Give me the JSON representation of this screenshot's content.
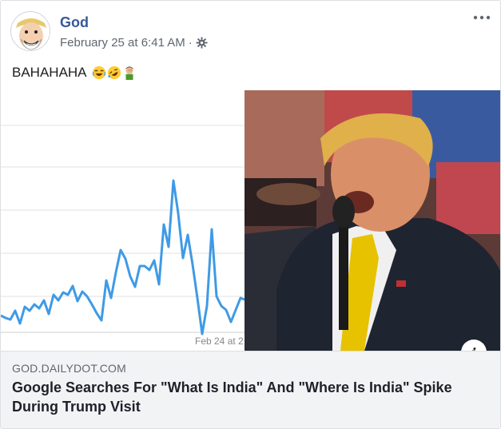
{
  "post": {
    "author": "God",
    "timestamp": "February 25 at 6:41 AM",
    "separator": "·",
    "audience_icon": "gear-icon",
    "more_icon": "more-options-icon",
    "status_text": "BAHAHAHA",
    "status_emojis": [
      "laughing-face-emoji",
      "rolling-laughing-emoji",
      "man-facepalming-emoji"
    ]
  },
  "media": {
    "chart_tick_label": "Feb 24 at 2",
    "info_label": "i",
    "chart_color": "#3f9ae6"
  },
  "link": {
    "domain": "GOD.DAILYDOT.COM",
    "headline": "Google Searches For \"What Is India\" And \"Where Is India\" Spike During Trump Visit"
  },
  "colors": {
    "author": "#385898",
    "meta": "#606770",
    "card_bg": "#f2f3f5"
  }
}
